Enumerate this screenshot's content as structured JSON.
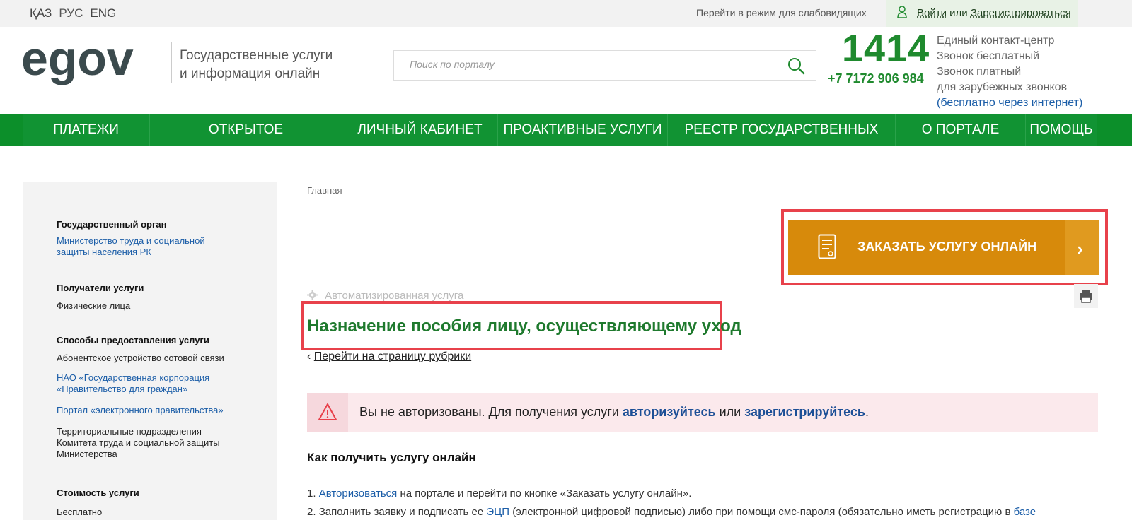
{
  "topbar": {
    "languages": [
      "ҚАЗ",
      "РУС",
      "ENG"
    ],
    "low_vision": "Перейти в режим для слабовидящих",
    "login": "Войти",
    "or": "или",
    "register": "Зарегистрироваться"
  },
  "header": {
    "logo_text": "egov",
    "tagline_line1": "Государственные услуги",
    "tagline_line2": "и информация онлайн",
    "search_placeholder": "Поиск по порталу",
    "phone_short": "1414",
    "phone_long": "+7 7172 906 984",
    "contact_line1": "Единый контакт-центр",
    "contact_line2": "Звонок бесплатный",
    "contact_line3": "Звонок платный",
    "contact_line4": "для зарубежных звонков",
    "contact_line5": "(бесплатно через интернет)"
  },
  "nav": {
    "items": [
      "ПЛАТЕЖИ",
      "ОТКРЫТОЕ ПРАВИТЕЛЬСТВО",
      "ЛИЧНЫЙ КАБИНЕТ",
      "ПРОАКТИВНЫЕ УСЛУГИ",
      "РЕЕСТР ГОСУДАРСТВЕННЫХ УСЛУГ",
      "О ПОРТАЛЕ",
      "ПОМОЩЬ"
    ]
  },
  "sidebar": {
    "gov_body_title": "Государственный орган",
    "gov_body_line1": "Министерство труда и социальной",
    "gov_body_line2": "защиты населения РК",
    "recipients_title": "Получатели услуги",
    "recipients_value": "Физические лица",
    "methods_title": "Способы предоставления услуги",
    "method1": "Абонентское устройство сотовой связи",
    "method2_line1": "НАО «Государственная корпорация",
    "method2_line2": "«Правительство для граждан»",
    "method3": "Портал «электронного правительства»",
    "method4_line1": "Территориальные подразделения",
    "method4_line2": "Комитета труда и социальной защиты",
    "method4_line3": "Министерства",
    "cost_title": "Стоимость услуги",
    "cost_value": "Бесплатно"
  },
  "main": {
    "breadcrumb": "Главная",
    "order_button": "ЗАКАЗАТЬ УСЛУГУ ОНЛАЙН",
    "auto_service": "Автоматизированная услуга",
    "title": "Назначение пособия лицу, осуществляющему уход",
    "back_link": "Перейти на страницу рубрики",
    "alert_prefix": "Вы не авторизованы. Для получения услуги",
    "alert_auth": "авторизуйтесь",
    "alert_or": "или",
    "alert_register": "зарегистрируйтесь",
    "alert_suffix": ".",
    "how_title": "Как получить услугу онлайн",
    "step1_num": "1.",
    "step1_link": "Авторизоваться",
    "step1_text": "на портале и перейти по кнопке «Заказать услугу онлайн».",
    "step2_num": "2.",
    "step2_pre": "Заполнить заявку и подписать ее",
    "step2_link": "ЭЦП",
    "step2_text": "(электронной цифровой подписью) либо при помощи смс-пароля (обязательно иметь регистрацию в",
    "step2_link2": "базе"
  },
  "colors": {
    "green": "#119333",
    "orange": "#d78a0b",
    "title_green": "#1f7a2e",
    "link_blue": "#1c5ea8",
    "highlight_red": "#e8414b"
  }
}
